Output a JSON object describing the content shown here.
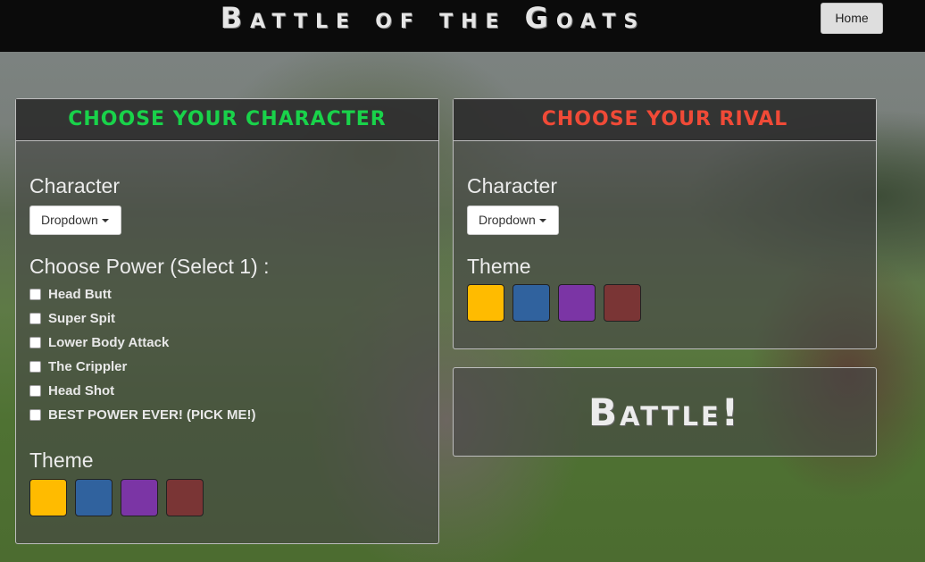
{
  "header": {
    "title": "Battle of the Goats",
    "home_label": "Home"
  },
  "character_panel": {
    "heading": "Choose Your Character",
    "character_label": "Character",
    "dropdown_label": "Dropdown",
    "power_heading": "Choose Power (Select 1) :",
    "powers": [
      "Head Butt",
      "Super Spit",
      "Lower Body Attack",
      "The Crippler",
      "Head Shot",
      "BEST POWER EVER! (PICK ME!)"
    ],
    "theme_label": "Theme"
  },
  "rival_panel": {
    "heading": "Choose Your Rival",
    "character_label": "Character",
    "dropdown_label": "Dropdown",
    "theme_label": "Theme"
  },
  "battle_label": "Battle!",
  "theme_colors": [
    "#ffbb00",
    "#30629e",
    "#7b35a5",
    "#7a3535"
  ],
  "heading_colors": {
    "character": "#19d24a",
    "rival": "#f04a37"
  }
}
